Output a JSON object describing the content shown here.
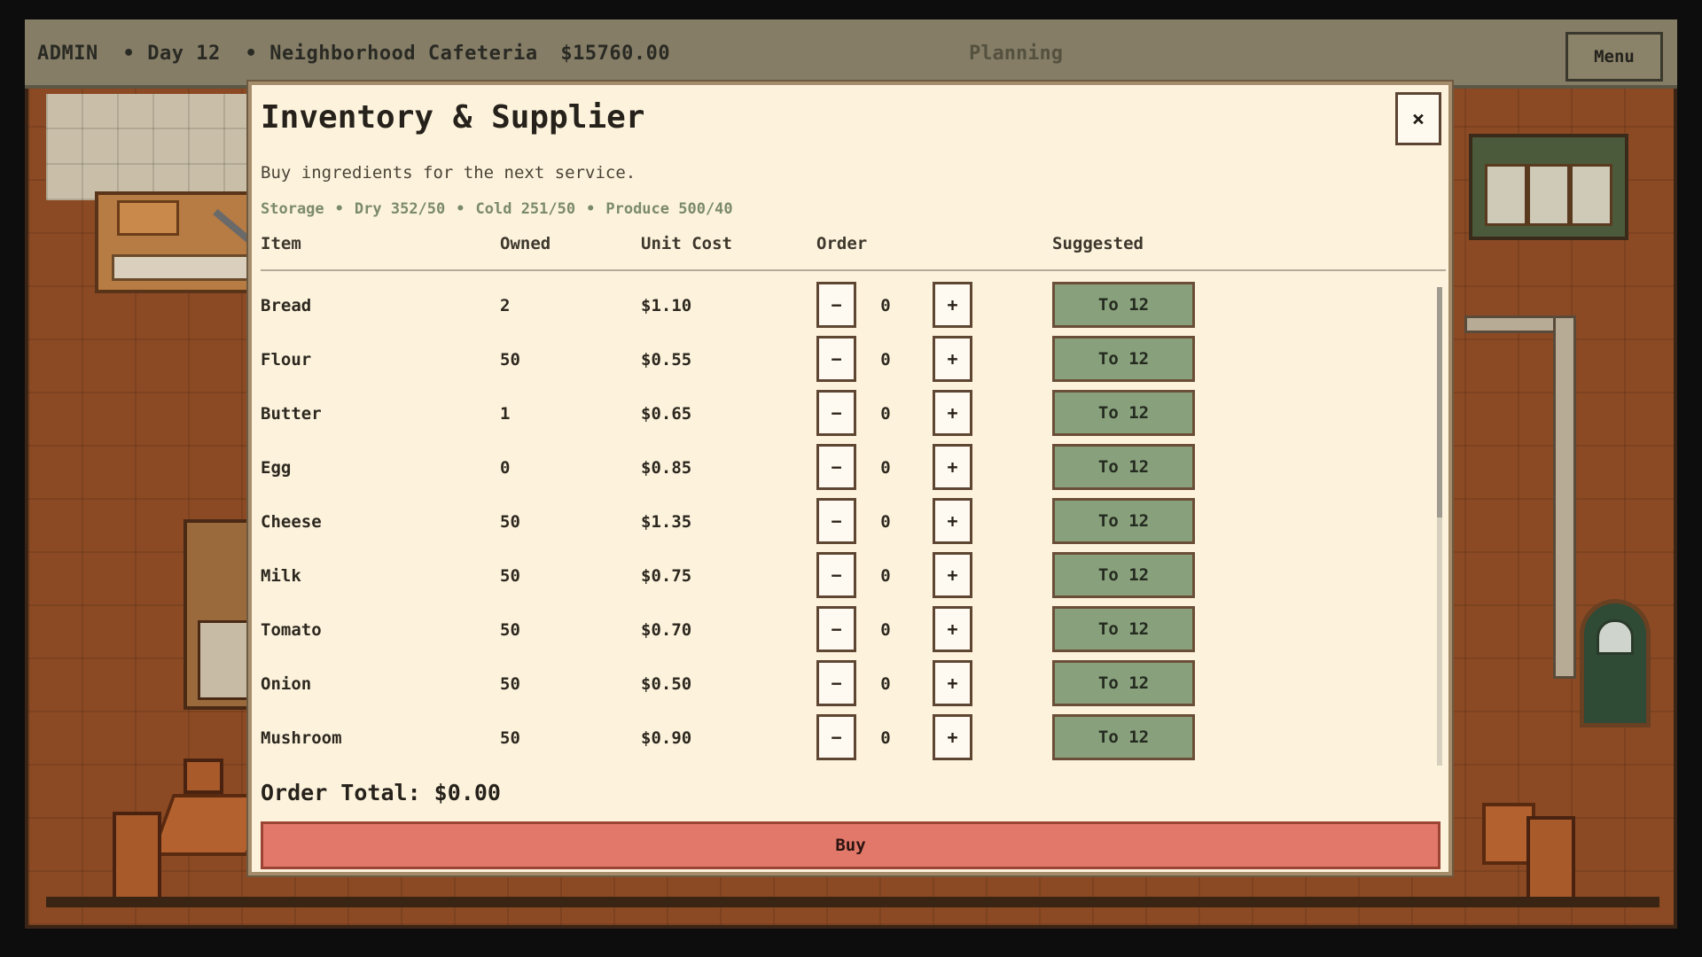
{
  "hud": {
    "role": "ADMIN",
    "day": "Day 12",
    "sep": "•",
    "cafe_name": "Neighborhood Cafeteria",
    "money": "$15760.00",
    "phase": "Planning",
    "menu_label": "Menu"
  },
  "modal": {
    "title": "Inventory & Supplier",
    "close_label": "×",
    "subtitle": "Buy ingredients for the next service.",
    "storage": {
      "label": "Storage",
      "dry": "Dry 352/50",
      "cold": "Cold 251/50",
      "produce": "Produce 500/40",
      "sep": "•"
    },
    "columns": {
      "item": "Item",
      "owned": "Owned",
      "unit_cost": "Unit Cost",
      "order": "Order",
      "suggested": "Suggested"
    },
    "minus_label": "−",
    "plus_label": "+",
    "items": [
      {
        "name": "Bread",
        "owned": "2",
        "cost": "$1.10",
        "order": "0",
        "suggest": "To 12"
      },
      {
        "name": "Flour",
        "owned": "50",
        "cost": "$0.55",
        "order": "0",
        "suggest": "To 12"
      },
      {
        "name": "Butter",
        "owned": "1",
        "cost": "$0.65",
        "order": "0",
        "suggest": "To 12"
      },
      {
        "name": "Egg",
        "owned": "0",
        "cost": "$0.85",
        "order": "0",
        "suggest": "To 12"
      },
      {
        "name": "Cheese",
        "owned": "50",
        "cost": "$1.35",
        "order": "0",
        "suggest": "To 12"
      },
      {
        "name": "Milk",
        "owned": "50",
        "cost": "$0.75",
        "order": "0",
        "suggest": "To 12"
      },
      {
        "name": "Tomato",
        "owned": "50",
        "cost": "$0.70",
        "order": "0",
        "suggest": "To 12"
      },
      {
        "name": "Onion",
        "owned": "50",
        "cost": "$0.50",
        "order": "0",
        "suggest": "To 12"
      },
      {
        "name": "Mushroom",
        "owned": "50",
        "cost": "$0.90",
        "order": "0",
        "suggest": "To 12"
      }
    ],
    "order_total": "Order Total: $0.00",
    "buy_label": "Buy"
  }
}
